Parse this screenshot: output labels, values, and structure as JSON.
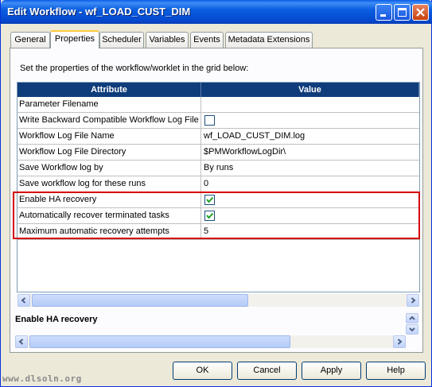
{
  "window": {
    "title": "Edit Workflow - wf_LOAD_CUST_DIM"
  },
  "tabs": [
    "General",
    "Properties",
    "Scheduler",
    "Variables",
    "Events",
    "Metadata Extensions"
  ],
  "active_tab": "Properties",
  "description": "Set the properties of the workflow/worklet in the grid below:",
  "grid": {
    "columns": [
      "Attribute",
      "Value"
    ],
    "rows": [
      {
        "attribute": "Parameter Filename",
        "value": ""
      },
      {
        "attribute": "Write Backward Compatible Workflow Log File",
        "value": "",
        "checkbox": false
      },
      {
        "attribute": "Workflow Log File Name",
        "value": "wf_LOAD_CUST_DIM.log"
      },
      {
        "attribute": "Workflow Log File Directory",
        "value": "$PMWorkflowLogDir\\"
      },
      {
        "attribute": "Save Workflow log by",
        "value": "By runs"
      },
      {
        "attribute": "Save workflow log for these runs",
        "value": "0"
      },
      {
        "attribute": "Enable HA recovery",
        "value": "",
        "checkbox": true
      },
      {
        "attribute": "Automatically recover terminated tasks",
        "value": "",
        "checkbox": true
      },
      {
        "attribute": "Maximum automatic recovery attempts",
        "value": "5"
      }
    ]
  },
  "info": {
    "title": "Enable HA recovery"
  },
  "buttons": {
    "ok": "OK",
    "cancel": "Cancel",
    "apply": "Apply",
    "help": "Help"
  },
  "watermark": "www.dlsoln.org"
}
